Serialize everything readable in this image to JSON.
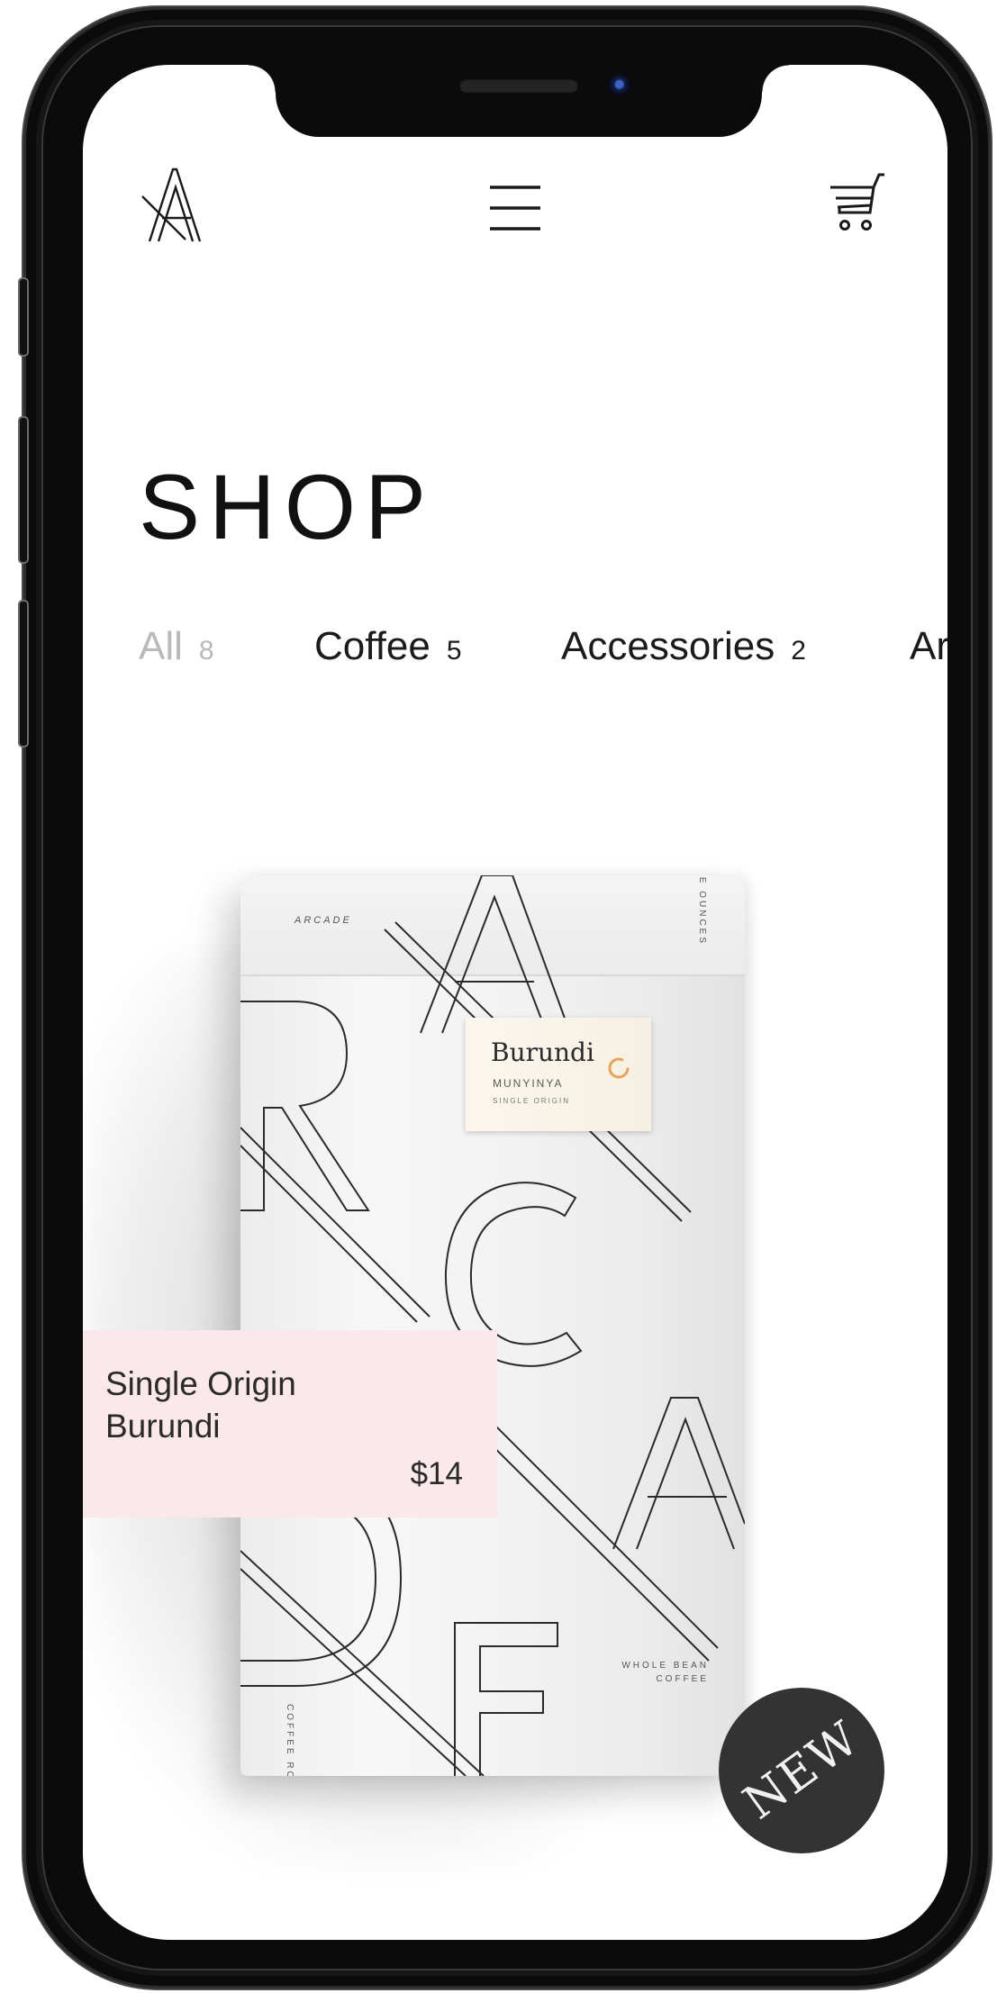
{
  "header": {
    "logo_icon": "arcade-a-logo",
    "menu_icon": "hamburger-icon",
    "cart_icon": "shopping-cart-icon"
  },
  "page": {
    "title": "SHOP"
  },
  "tabs": [
    {
      "label": "All",
      "count": "8",
      "active": true
    },
    {
      "label": "Coffee",
      "count": "5",
      "active": false
    },
    {
      "label": "Accessories",
      "count": "2",
      "active": false
    },
    {
      "label": "Ar",
      "count": "",
      "active": false
    }
  ],
  "product": {
    "name_line1": "Single Origin",
    "name_line2": "Burundi",
    "price": "$14",
    "badge": "NEW",
    "card_color": "#fbe8ea",
    "badge_color": "#333333",
    "bag": {
      "brand": "ARCADE",
      "weight": "TWELVE OUNCES",
      "roasters": "COFFEE ROASTERS",
      "whole_bean_line1": "WHOLE BEAN",
      "whole_bean_line2": "COFFEE",
      "label_name": "Burundi",
      "label_origin": "MUNYINYA",
      "label_type": "SINGLE ORIGIN",
      "big_letters": [
        "A",
        "R",
        "C",
        "A",
        "D",
        "E"
      ]
    }
  }
}
